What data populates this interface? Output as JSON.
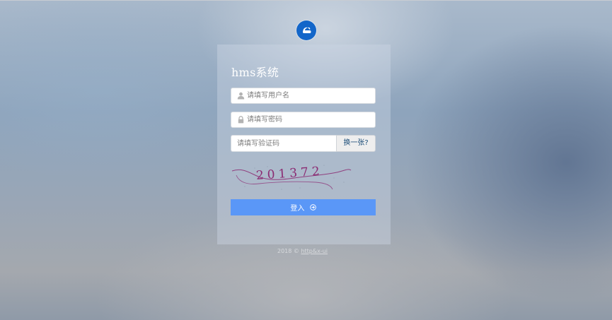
{
  "app": {
    "title": "hms系统"
  },
  "login_form": {
    "username_placeholder": "请填写用户名",
    "password_placeholder": "请填写密码",
    "captcha_placeholder": "请填写验证码",
    "refresh_captcha_label": "换一张?",
    "captcha_text": "201372",
    "login_label": "登入"
  },
  "footer": {
    "copyright": "2018 ©",
    "link_text": "http&x-ui"
  },
  "colors": {
    "accent": "#5a97f7",
    "logo": "#1366c9",
    "captcha_ink": "#8b2a72"
  },
  "icons": {
    "logo": "logo-icon",
    "username": "user-icon",
    "password": "lock-icon",
    "login": "arrow-right-circle-icon"
  }
}
